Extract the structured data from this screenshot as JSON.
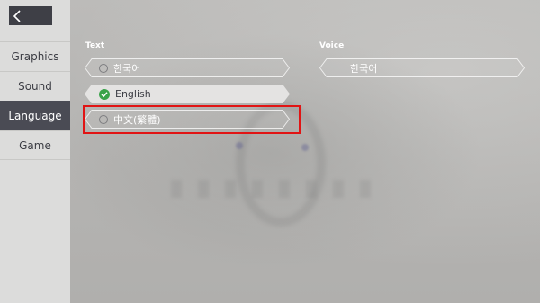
{
  "sidebar": {
    "back_icon": "chevron-left-icon",
    "items": [
      {
        "label": "Graphics",
        "active": false
      },
      {
        "label": "Sound",
        "active": false
      },
      {
        "label": "Language",
        "active": true
      },
      {
        "label": "Game",
        "active": false
      }
    ]
  },
  "text_section": {
    "label": "Text",
    "options": [
      {
        "label": "한국어",
        "selected": false
      },
      {
        "label": "English",
        "selected": true
      },
      {
        "label": "中文(繁體)",
        "selected": false
      }
    ]
  },
  "voice_section": {
    "label": "Voice",
    "options": [
      {
        "label": "한국어"
      }
    ]
  },
  "colors": {
    "accent_dark": "#4a4b54",
    "check_green": "#3aa34a",
    "highlight_red": "#e11414"
  }
}
